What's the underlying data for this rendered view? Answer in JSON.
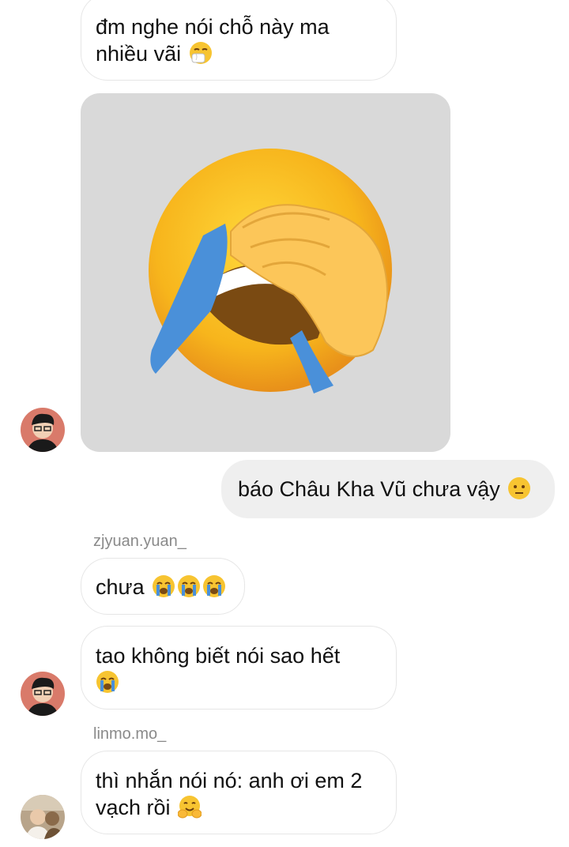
{
  "messages": [
    {
      "id": "m1",
      "direction": "incoming",
      "text": "đm nghe nói chỗ này ma nhiều vãi",
      "emoji": [
        "sneezing-face"
      ]
    },
    {
      "id": "m2",
      "direction": "incoming",
      "type": "image",
      "image_subject": "facepalm crying emoji sticker"
    },
    {
      "id": "m3",
      "direction": "outgoing",
      "text": "báo Châu Kha Vũ chưa vậy",
      "emoji": [
        "confused-face"
      ]
    },
    {
      "id": "m4",
      "direction": "incoming",
      "sender": "zjyuan.yuan_",
      "text": "chưa",
      "emoji": [
        "crying-face",
        "crying-face",
        "crying-face"
      ]
    },
    {
      "id": "m5",
      "direction": "incoming",
      "text": "tao không biết nói sao hết",
      "emoji": [
        "crying-face"
      ]
    },
    {
      "id": "m6",
      "direction": "incoming",
      "sender": "linmo.mo_",
      "text": "thì nhắn nói nó: anh ơi em 2 vạch rồi",
      "emoji": [
        "hugging-face"
      ]
    }
  ],
  "lines": {
    "m1_l1": "đm nghe nói chỗ này ma",
    "m1_l2": "nhiều vãi",
    "m5_l1": "tao không biết nói sao hết",
    "m6_l1": "thì nhắn nói nó: anh ơi em 2",
    "m6_l2": "vạch rồi"
  },
  "colors": {
    "outgoing_bubble": "#efefef",
    "incoming_border": "#e6e6e6",
    "sender_name": "#8a8a8a"
  }
}
